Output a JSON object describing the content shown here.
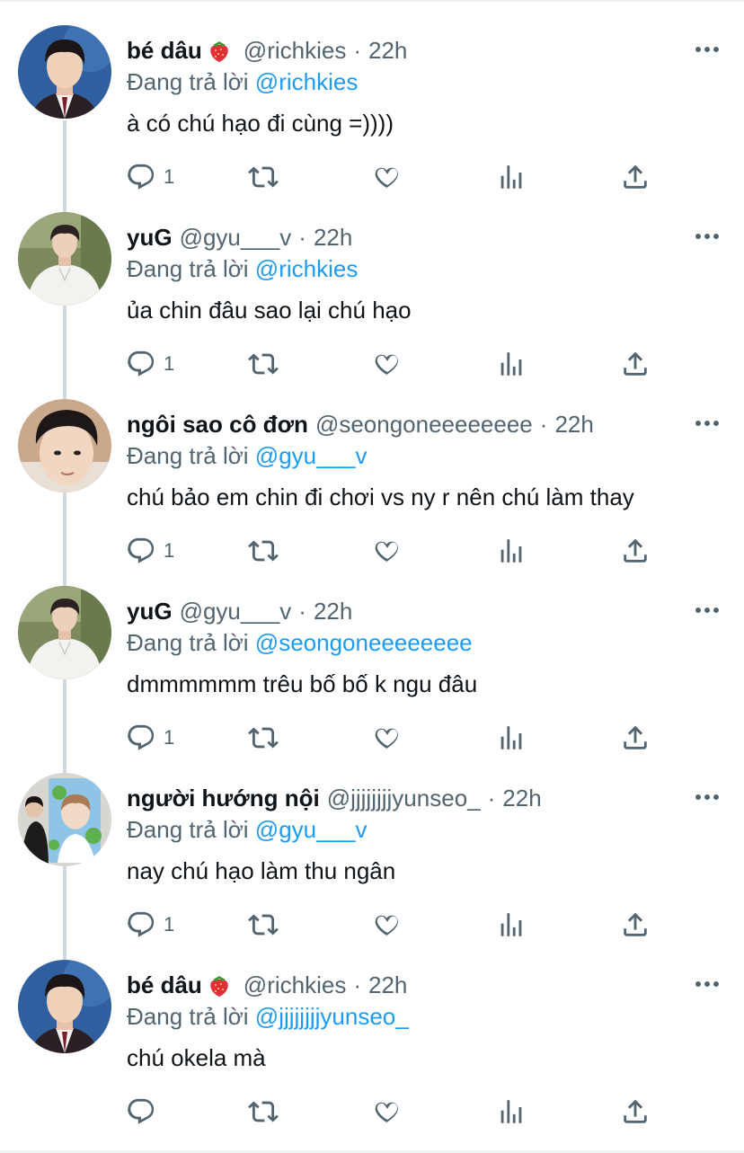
{
  "colors": {
    "link": "#1d9bf0",
    "muted": "#536471",
    "text": "#0f1419",
    "thread_line": "#cfd9de"
  },
  "replying_label": "Đang trả lời",
  "tweets": [
    {
      "name": "bé dâu",
      "has_emoji": true,
      "emoji_icon": "strawberry-icon",
      "handle": "@richkies",
      "time": "22h",
      "reply_to": "@richkies",
      "text": "à có chú hạo đi cùng =))))",
      "reply_count": "1",
      "avatar": "avatar-boy-uniform"
    },
    {
      "name": "yuG",
      "has_emoji": false,
      "handle": "@gyu___v",
      "time": "22h",
      "reply_to": "@richkies",
      "text": "ủa chin đâu sao lại chú hạo",
      "reply_count": "1",
      "avatar": "avatar-white-shirt"
    },
    {
      "name": "ngôi sao cô đơn",
      "has_emoji": false,
      "handle": "@seongoneeeeeeee",
      "time": "22h",
      "reply_to": "@gyu___v",
      "text": "chú bảo em chin đi chơi vs ny r nên chú làm thay",
      "reply_count": "1",
      "avatar": "avatar-closeup"
    },
    {
      "name": "yuG",
      "has_emoji": false,
      "handle": "@gyu___v",
      "time": "22h",
      "reply_to": "@seongoneeeeeeee",
      "text": "dmmmmmm trêu bố bố k ngu đâu",
      "reply_count": "1",
      "avatar": "avatar-white-shirt"
    },
    {
      "name": "người hướng nội",
      "has_emoji": false,
      "handle": "@jjjjjjjjyunseo_",
      "time": "22h",
      "reply_to": "@gyu___v",
      "text": "nay chú hạo làm thu ngân",
      "reply_count": "1",
      "avatar": "avatar-poster"
    },
    {
      "name": "bé dâu",
      "has_emoji": true,
      "emoji_icon": "strawberry-icon",
      "handle": "@richkies",
      "time": "22h",
      "reply_to": "@jjjjjjjjyunseo_",
      "text": "chú okela mà",
      "reply_count": "",
      "avatar": "avatar-boy-uniform"
    }
  ],
  "action_icons": [
    "reply-icon",
    "retweet-icon",
    "like-icon",
    "views-icon",
    "share-icon"
  ]
}
